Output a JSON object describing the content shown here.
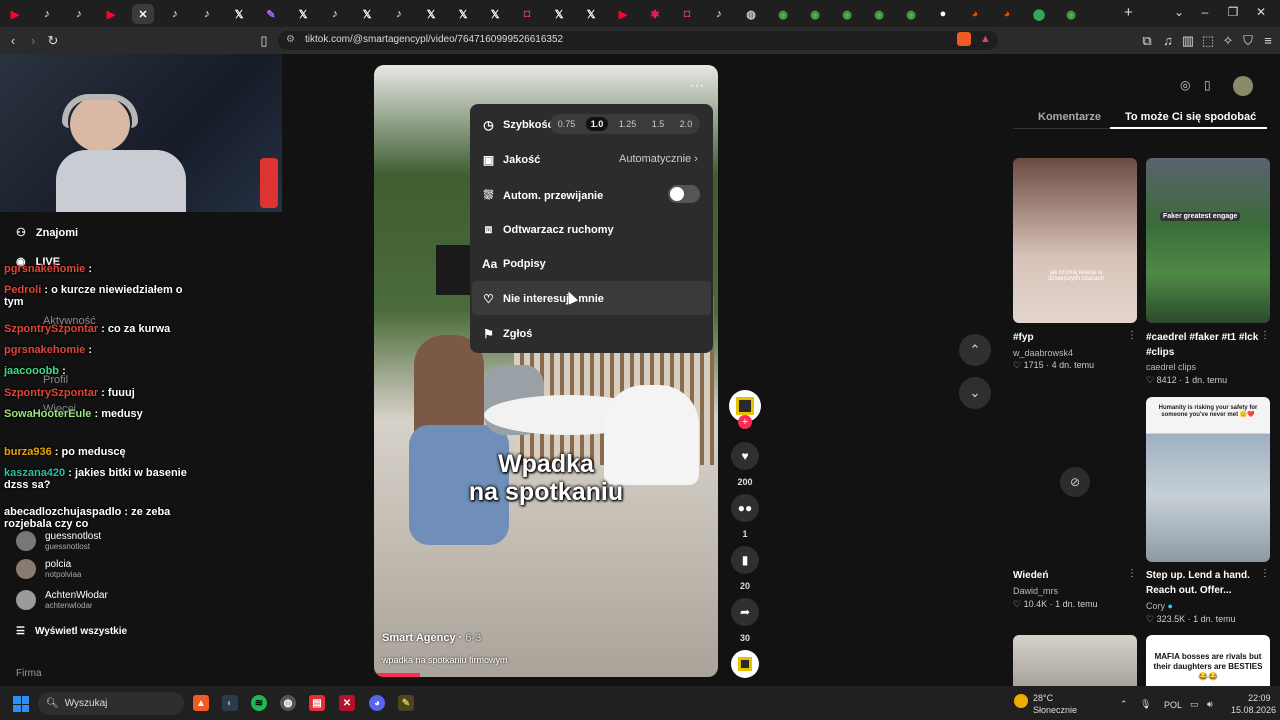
{
  "browser": {
    "url": "tiktok.com/@smartagencypl/video/7647160999526616352",
    "tabs": [
      {
        "icon": "youtube-icon",
        "color": "#ff0033"
      },
      {
        "icon": "tiktok-icon",
        "color": "#ffffff"
      },
      {
        "icon": "tiktok-icon",
        "color": "#ffffff"
      },
      {
        "icon": "youtube-icon",
        "color": "#ff0033"
      },
      {
        "icon": "close-icon",
        "color": "#ffffff",
        "active": true
      },
      {
        "icon": "tiktok-icon",
        "color": "#ffffff"
      },
      {
        "icon": "tiktok-icon",
        "color": "#ffffff"
      },
      {
        "icon": "x-icon",
        "color": "#ffffff"
      },
      {
        "icon": "pen-icon",
        "color": "#a46bff"
      },
      {
        "icon": "x-icon",
        "color": "#ffffff"
      },
      {
        "icon": "tiktok-icon",
        "color": "#ffffff"
      },
      {
        "icon": "x-icon",
        "color": "#ffffff"
      },
      {
        "icon": "tiktok-icon",
        "color": "#ffffff"
      },
      {
        "icon": "x-icon",
        "color": "#ffffff"
      },
      {
        "icon": "x-icon",
        "color": "#ffffff"
      },
      {
        "icon": "x-icon",
        "color": "#ffffff"
      },
      {
        "icon": "instagram-icon",
        "color": "#e1306c"
      },
      {
        "icon": "x-icon",
        "color": "#ffffff"
      },
      {
        "icon": "x-icon",
        "color": "#ffffff"
      },
      {
        "icon": "youtube-icon",
        "color": "#ff0033"
      },
      {
        "icon": "slack-icon",
        "color": "#e01e5a"
      },
      {
        "icon": "instagram-icon",
        "color": "#e1306c"
      },
      {
        "icon": "tiktok-icon",
        "color": "#ffffff"
      },
      {
        "icon": "globe-icon",
        "color": "#cccccc"
      },
      {
        "icon": "chrome-icon",
        "color": "#4caf50"
      },
      {
        "icon": "chrome-icon",
        "color": "#4caf50"
      },
      {
        "icon": "chrome-icon",
        "color": "#4caf50"
      },
      {
        "icon": "chrome-icon",
        "color": "#4caf50"
      },
      {
        "icon": "chrome-icon",
        "color": "#4caf50"
      },
      {
        "icon": "circle-icon",
        "color": "#ffffff"
      },
      {
        "icon": "reddit-icon",
        "color": "#ff4500"
      },
      {
        "icon": "reddit-icon",
        "color": "#ff4500"
      },
      {
        "icon": "maps-icon",
        "color": "#34a853"
      },
      {
        "icon": "chrome-icon",
        "color": "#4caf50"
      }
    ],
    "new_tab": "+"
  },
  "sidebar": {
    "friends": "Znajomi",
    "live": "LIVE",
    "activity": "Aktywność",
    "profile": "Profil",
    "more": "Więcej",
    "following_users": [
      {
        "name": "guessnotlost",
        "handle": "guessnotlost"
      },
      {
        "name": "polcia",
        "handle": "notpolviaa"
      },
      {
        "name": "AchtenWłodar",
        "handle": "achtenwlodar"
      }
    ],
    "show_all": "Wyświetl wszystkie",
    "company": "Firma"
  },
  "chat": [
    {
      "user": "pgrsnakehomie",
      "sep": " : ",
      "text": "",
      "color": "#e0453b"
    },
    {
      "user": "Pedroli",
      "sep": " : ",
      "text": "o kurcze niewiedziałem o tym",
      "color": "#e0453b"
    },
    {
      "user": "SzpontrySzpontar",
      "sep": " : ",
      "text": "co za kurwa",
      "color": "#e0453b"
    },
    {
      "user": "pgrsnakehomie",
      "sep": " : ",
      "text": "",
      "color": "#e0453b"
    },
    {
      "user": "jaacooobb",
      "sep": " : ",
      "text": "",
      "color": "#3ddc84"
    },
    {
      "user": "SzpontrySzpontar",
      "sep": " : ",
      "text": "fuuuj",
      "color": "#e0453b"
    },
    {
      "user": "SowaHooterEule",
      "sep": " : ",
      "text": "medusy",
      "color": "#9be37a"
    },
    {
      "user": "burza936",
      "sep": " : ",
      "text": "po meduscę",
      "color": "#e6a600"
    },
    {
      "user": "kaszana420",
      "sep": " : ",
      "text": "jakies bitki w basenie dzss sa?",
      "color": "#2bc0a0"
    },
    {
      "user": "abecadlozchujaspadlo",
      "sep": " : ",
      "text": "ze zeba rozjebala czy co",
      "color": "#ffffff"
    }
  ],
  "video": {
    "title_line1": "Wpadka",
    "title_line2": "na spotkaniu",
    "author": "Smart Agency",
    "date": "6-3",
    "caption": "wpadka na spotkaniu firmowym"
  },
  "menu": {
    "speed_label": "Szybkość",
    "speeds": [
      "0.75",
      "1.0",
      "1.25",
      "1.5",
      "2.0"
    ],
    "selected_speed": "1.0",
    "quality_label": "Jakość",
    "quality_value": "Automatycznie",
    "autoscroll_label": "Autom. przewijanie",
    "autoscroll_on": false,
    "floating_label": "Odtwarzacz ruchomy",
    "captions_label": "Podpisy",
    "not_interested_label": "Nie interesuje mnie",
    "report_label": "Zgłoś"
  },
  "actions": {
    "likes": "200",
    "comments": "1",
    "saves": "20",
    "shares": "30"
  },
  "panel": {
    "tab_comments": "Komentarze",
    "tab_related": "To może Ci się spodobać",
    "cards": [
      {
        "title": "#fyp",
        "author": "w_daabrowsk4",
        "likes": "1715",
        "age": "4 dn. temu",
        "overlay": "jak brzmią relacje w dzisiejszych czasach"
      },
      {
        "title": "#caedrel #faker #t1 #lck #clips",
        "author": "caedrel clips",
        "likes": "8412",
        "age": "1 dn. temu",
        "overlay": "Faker greatest engage"
      },
      {
        "title": "Wiedeń",
        "author": "Dawid_mrs",
        "likes": "10.4K",
        "age": "1 dn. temu",
        "overlay": ""
      },
      {
        "title": "Step up. Lend a hand. Reach out. Offer...",
        "author": "Cory",
        "likes": "323.5K",
        "age": "1 dn. temu",
        "overlay": "Humanity is risking your safety for someone you've never met 🫡❤️"
      },
      {
        "title": "",
        "author": "",
        "likes": "",
        "age": "",
        "overlay": "MAFIA bosses are rivals but their daughters are BESTIES 😂😂"
      }
    ]
  },
  "taskbar": {
    "search_placeholder": "Wyszukaj",
    "weather_temp": "28°C",
    "weather_desc": "Słonecznie",
    "lang": "POL",
    "time": "22:09",
    "date": "15.08.2026"
  }
}
